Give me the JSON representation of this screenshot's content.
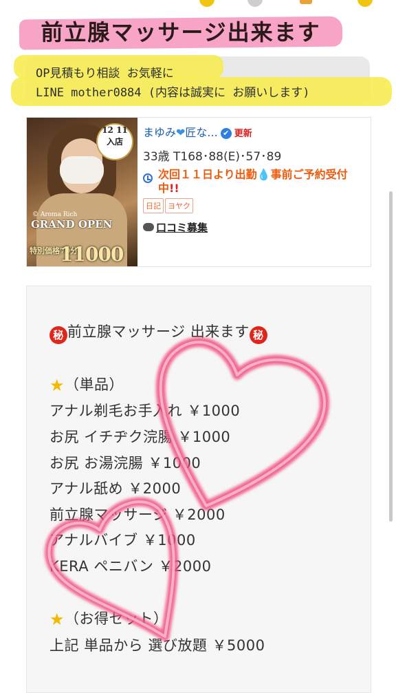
{
  "header": {
    "headline": "前立腺マッサージ出来ます"
  },
  "note": {
    "line1": "OP見積もり相談 お気軽に",
    "line2": "LINE mother0884 (内容は誠実に お願いします)"
  },
  "profile": {
    "badge_line1": "12 11",
    "badge_line2": "入店",
    "shop": "© Aroma Rich",
    "grand_open": "GRAND OPEN",
    "price_small": "特別価格70分",
    "price_big": "11000",
    "name": "まゆみ",
    "name_suffix": "匠な...",
    "updated": "更新",
    "stats": "33歳 T168･88(E)･57･89",
    "shift_text": "次回１１日より出勤",
    "shift_text2": "事前ご予約受付中",
    "tags": [
      "日記",
      "ヨヤク"
    ],
    "reviews_label": "口コミ募集"
  },
  "description": {
    "title": "前立腺マッサージ 出来ます",
    "secret_symbol": "秘",
    "single_header": "（単品）",
    "items": [
      "アナル剃毛お手入れ ￥1000",
      "お尻 イチヂク浣腸 ￥1000",
      "お尻 お湯浣腸 ￥1000",
      "アナル舐め ￥2000",
      "前立腺マッサージ ￥2000",
      "アナルバイブ ￥1000",
      "KERA ペニバン ￥2000"
    ],
    "set_header": "（お得セット）",
    "set_item": "上記 単品から 選び放題 ￥5000"
  },
  "colors": {
    "headline_highlight": "#f79ac0",
    "note_highlight": "#f7ec52",
    "shift_text": "#f05a0c",
    "heart_overlay": "#f0507f"
  },
  "icons": {
    "verified": "verified-check-icon",
    "clock": "clock-icon",
    "drop": "droplet-icon",
    "speech": "speech-bubble-icon",
    "star": "star-icon",
    "secret": "secret-circle-icon",
    "heart": "heart-icon"
  }
}
